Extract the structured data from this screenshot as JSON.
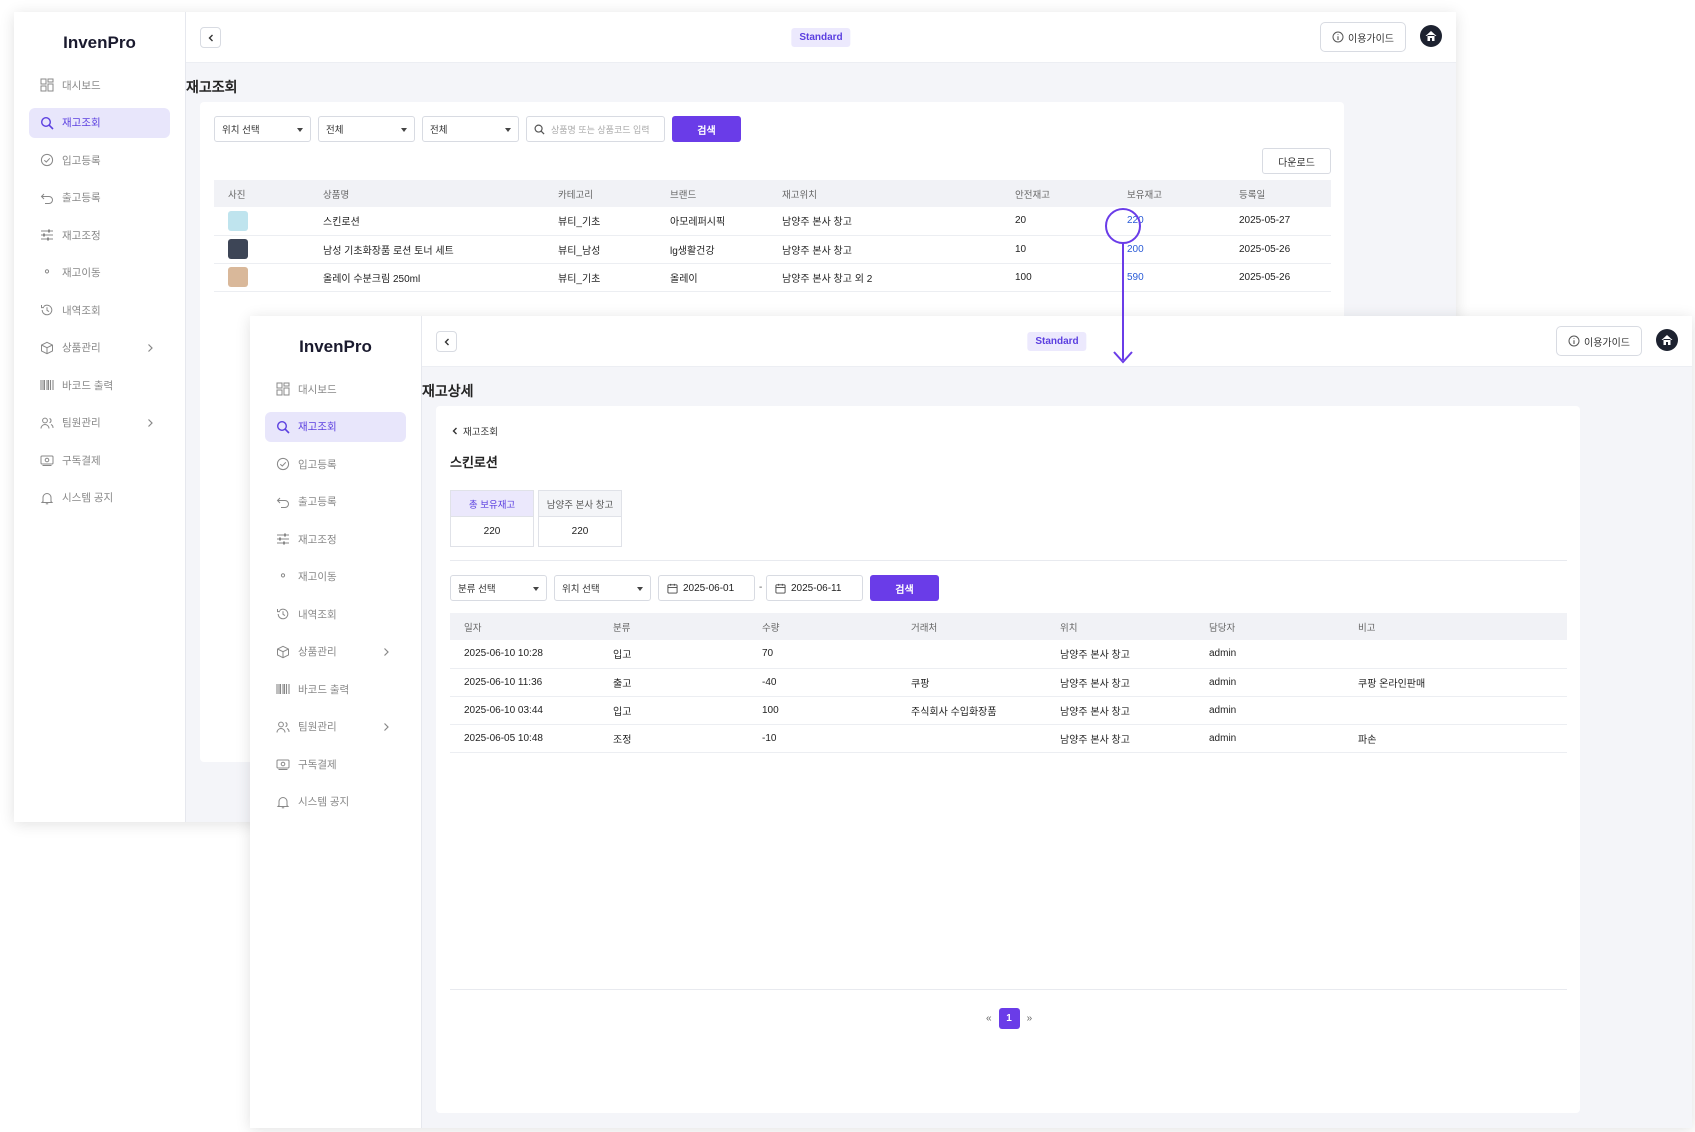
{
  "app": {
    "name": "InvenPro",
    "plan": "Standard",
    "guide_label": "이용가이드"
  },
  "sidebar": {
    "items": [
      {
        "label": "대시보드",
        "icon": "dashboard-icon"
      },
      {
        "label": "재고조회",
        "icon": "search-icon",
        "active": true
      },
      {
        "label": "입고등록",
        "icon": "check-circle-icon"
      },
      {
        "label": "출고등록",
        "icon": "return-icon"
      },
      {
        "label": "재고조정",
        "icon": "sliders-icon"
      },
      {
        "label": "재고이동",
        "icon": "location-pin-icon"
      },
      {
        "label": "내역조회",
        "icon": "history-icon"
      },
      {
        "label": "상품관리",
        "icon": "box-icon",
        "has_submenu": true
      },
      {
        "label": "바코드 출력",
        "icon": "barcode-icon"
      },
      {
        "label": "팀원관리",
        "icon": "users-icon",
        "has_submenu": true
      },
      {
        "label": "구독결제",
        "icon": "payment-icon"
      },
      {
        "label": "시스템 공지",
        "icon": "bell-icon"
      }
    ]
  },
  "inventory": {
    "title": "재고조회",
    "filters": {
      "location": "위치 선택",
      "category": "전체",
      "brand": "전체",
      "search_placeholder": "상품명 또는 상품코드 입력",
      "search_button": "검색"
    },
    "download_button": "다운로드",
    "columns": [
      "사진",
      "상품명",
      "카테고리",
      "브랜드",
      "재고위치",
      "안전재고",
      "보유재고",
      "등록일"
    ],
    "rows": [
      {
        "name": "스킨로션",
        "category": "뷰티_기초",
        "brand": "아모레퍼시픽",
        "location": "남양주 본사 창고",
        "safety": "20",
        "stock": "220",
        "date": "2025-05-27"
      },
      {
        "name": "남성 기초화장품 로션 토너 세트",
        "category": "뷰티_남성",
        "brand": "lg생활건강",
        "location": "남양주 본사 창고",
        "safety": "10",
        "stock": "200",
        "date": "2025-05-26"
      },
      {
        "name": "올레이 수분크림 250ml",
        "category": "뷰티_기초",
        "brand": "올레이",
        "location": "남양주 본사 창고 외 2",
        "safety": "100",
        "stock": "590",
        "date": "2025-05-26"
      }
    ]
  },
  "detail": {
    "title": "재고상세",
    "back_label": "재고조회",
    "product_name": "스킨로션",
    "stock_summary": [
      {
        "label": "총 보유재고",
        "value": "220"
      },
      {
        "label": "남양주 본사 창고",
        "value": "220"
      }
    ],
    "filters": {
      "type": "분류 선택",
      "location": "위치 선택",
      "date_from": "2025-06-01",
      "date_sep": "-",
      "date_to": "2025-06-11",
      "search_button": "검색"
    },
    "columns": [
      "일자",
      "분류",
      "수량",
      "거래처",
      "위치",
      "담당자",
      "비고"
    ],
    "rows": [
      {
        "date": "2025-06-10 10:28",
        "type": "입고",
        "qty": "70",
        "vendor": "",
        "location": "남양주 본사 창고",
        "manager": "admin",
        "note": ""
      },
      {
        "date": "2025-06-10 11:36",
        "type": "출고",
        "qty": "-40",
        "vendor": "쿠팡",
        "location": "남양주 본사 창고",
        "manager": "admin",
        "note": "쿠팡 온라인판매"
      },
      {
        "date": "2025-06-10 03:44",
        "type": "입고",
        "qty": "100",
        "vendor": "주식회사 수입화장품",
        "location": "남양주 본사 창고",
        "manager": "admin",
        "note": ""
      },
      {
        "date": "2025-06-05 10:48",
        "type": "조정",
        "qty": "-10",
        "vendor": "",
        "location": "남양주 본사 창고",
        "manager": "admin",
        "note": "파손"
      }
    ],
    "pagination": {
      "prev": "«",
      "current": "1",
      "next": "»"
    }
  },
  "colors": {
    "accent": "#6a3ce8",
    "active_bg": "#e8e6fb",
    "link": "#2a5bd7"
  }
}
